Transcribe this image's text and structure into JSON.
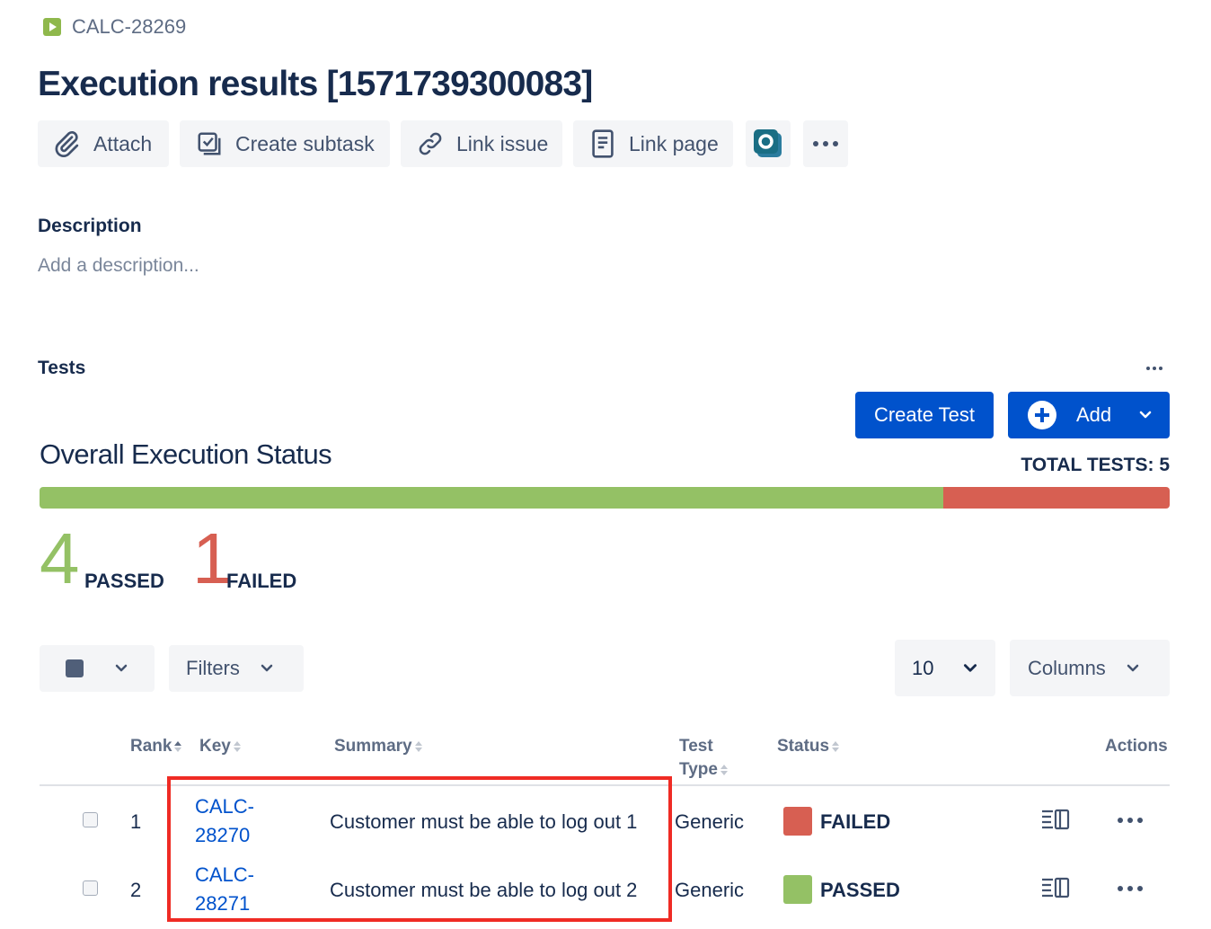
{
  "breadcrumb": {
    "issue_key": "CALC-28269"
  },
  "page_title": "Execution results [1571739300083]",
  "toolbar": {
    "attach": "Attach",
    "create_subtask": "Create subtask",
    "link_issue": "Link issue",
    "link_page": "Link page"
  },
  "description": {
    "label": "Description",
    "placeholder": "Add a description..."
  },
  "tests": {
    "label": "Tests",
    "create_test": "Create Test",
    "add": "Add",
    "overall_title": "Overall Execution Status",
    "total_tests": "TOTAL TESTS: 5",
    "passed_count": "4",
    "passed_label": "PASSED",
    "failed_count": "1",
    "failed_label": "FAILED",
    "progress": {
      "passed": 4,
      "failed": 1,
      "total": 5
    },
    "colors": {
      "passed": "#94c165",
      "failed": "#d75f52"
    }
  },
  "filters": {
    "filters_label": "Filters",
    "page_size": "10",
    "columns_label": "Columns"
  },
  "table": {
    "headers": {
      "rank": "Rank",
      "key": "Key",
      "summary": "Summary",
      "test_type": "Test Type",
      "status": "Status",
      "actions": "Actions"
    },
    "rows": [
      {
        "rank": "1",
        "key_line1": "CALC-",
        "key_line2": "28270",
        "summary": "Customer must be able to log out 1",
        "test_type": "Generic",
        "status": "FAILED",
        "status_color": "#d75f52"
      },
      {
        "rank": "2",
        "key_line1": "CALC-",
        "key_line2": "28271",
        "summary": "Customer must be able to log out 2",
        "test_type": "Generic",
        "status": "PASSED",
        "status_color": "#94c165"
      }
    ]
  },
  "annotation": {
    "highlight_color": "#ef2b24"
  }
}
